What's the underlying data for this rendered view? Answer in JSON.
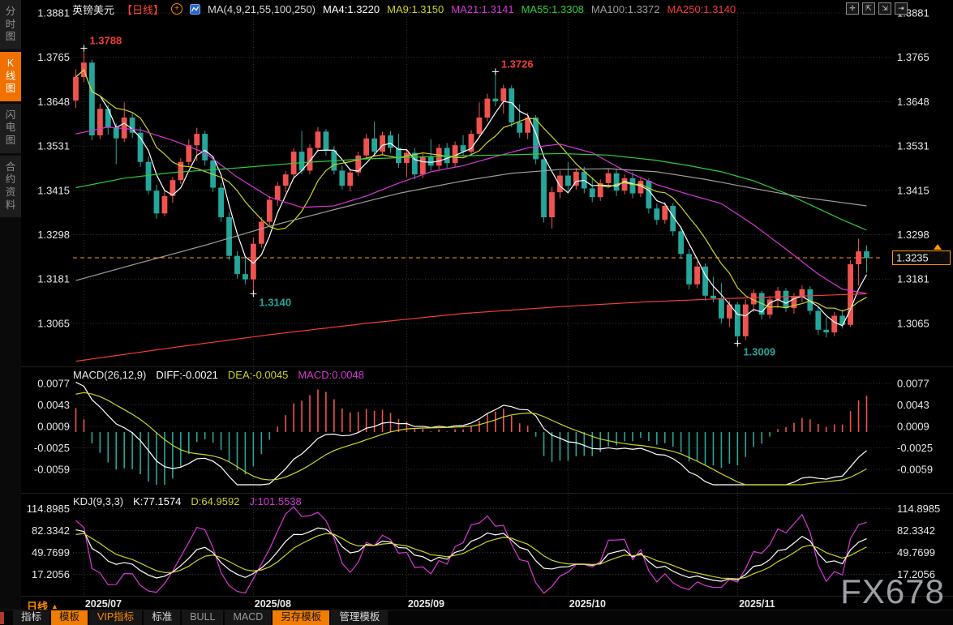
{
  "window": {
    "watermark": "FX678"
  },
  "sidebar": {
    "tabs": [
      {
        "label": "分时图",
        "active": false
      },
      {
        "label": "K线图",
        "active": true
      },
      {
        "label": "闪电图",
        "active": false
      },
      {
        "label": "合约资料",
        "active": false
      }
    ]
  },
  "header": {
    "symbol": "英镑美元",
    "period_tag": "【日线】",
    "add_icon_glyph": "+",
    "ma_settings": "MA(4,9,21,55,100,250)",
    "ma_values": [
      {
        "label": "MA4:1.3220",
        "color": "#ffffff"
      },
      {
        "label": "MA9:1.3150",
        "color": "#cdd421"
      },
      {
        "label": "MA21:1.3141",
        "color": "#d837d8"
      },
      {
        "label": "MA55:1.3308",
        "color": "#2ecc40"
      },
      {
        "label": "MA100:1.3372",
        "color": "#9e9e9e"
      },
      {
        "label": "MA250:1.3140",
        "color": "#f23c3c"
      }
    ],
    "toolbar_icons": [
      {
        "name": "pan-icon",
        "glyph": "✛"
      },
      {
        "name": "fit-left-icon",
        "glyph": "⇱"
      },
      {
        "name": "fit-right-icon",
        "glyph": "⇲"
      },
      {
        "name": "jump-latest-icon",
        "glyph": "⇥"
      }
    ]
  },
  "macd_panel": {
    "title": "MACD(26,12,9)",
    "values": [
      {
        "label": "DIFF:-0.0021",
        "color": "#ffffff"
      },
      {
        "label": "DEA:-0.0045",
        "color": "#cdd421"
      },
      {
        "label": "MACD:0.0048",
        "color": "#d837d8"
      }
    ]
  },
  "kdj_panel": {
    "title": "KDJ(9,3,3)",
    "values": [
      {
        "label": "K:77.1574",
        "color": "#ffffff"
      },
      {
        "label": "D:64.9592",
        "color": "#cdd421"
      },
      {
        "label": "J:101.5538",
        "color": "#d837d8"
      }
    ]
  },
  "footer": {
    "period_label": "日线",
    "period_arrow": "▲",
    "tabs": [
      {
        "label": "指标",
        "style": "plain"
      },
      {
        "label": "模板",
        "style": "orange-bg"
      },
      {
        "label": "VIP指标",
        "style": "orange-text"
      },
      {
        "label": "标准",
        "style": "plain"
      },
      {
        "label": "BULL",
        "style": "dim"
      },
      {
        "label": "MACD",
        "style": "dim"
      },
      {
        "label": "另存模板",
        "style": "orange-bg"
      },
      {
        "label": "管理模板",
        "style": "plain"
      }
    ]
  },
  "chart_data": {
    "type": "candlestick+indicators",
    "title": "英镑美元 日线 (GBP/USD daily)",
    "price_axis_ticks": [
      "1.3881",
      "1.3765",
      "1.3648",
      "1.3531",
      "1.3415",
      "1.3298",
      "1.3181",
      "1.3065"
    ],
    "macd_axis_ticks": [
      "0.0077",
      "0.0043",
      "0.0009",
      "-0.0025",
      "-0.0059"
    ],
    "kdj_axis_ticks": [
      "114.8985",
      "82.3342",
      "49.7699",
      "17.2056"
    ],
    "dates": [
      "2025/07",
      "2025/08",
      "2025/09",
      "2025/10",
      "2025/11"
    ],
    "month_start_indices": [
      1,
      22,
      41,
      61,
      82
    ],
    "current_price": "1.3235",
    "current_price_value": 1.3235,
    "annotations": [
      {
        "index": 1,
        "price": 1.3788,
        "label": "1.3788",
        "kind": "high"
      },
      {
        "index": 52,
        "price": 1.3726,
        "label": "1.3726",
        "kind": "high"
      },
      {
        "index": 22,
        "price": 1.314,
        "label": "1.3140",
        "kind": "low"
      },
      {
        "index": 82,
        "price": 1.3009,
        "label": "1.3009",
        "kind": "low"
      }
    ],
    "candles_ohlc": [
      [
        1.365,
        1.3732,
        1.363,
        1.3712
      ],
      [
        1.3712,
        1.3788,
        1.3698,
        1.375
      ],
      [
        1.375,
        1.3758,
        1.3545,
        1.3558
      ],
      [
        1.3558,
        1.3642,
        1.3548,
        1.3628
      ],
      [
        1.3628,
        1.3638,
        1.356,
        1.3578
      ],
      [
        1.3578,
        1.359,
        1.3482,
        1.355
      ],
      [
        1.355,
        1.3645,
        1.354,
        1.3605
      ],
      [
        1.3605,
        1.3618,
        1.3552,
        1.3565
      ],
      [
        1.3565,
        1.358,
        1.3475,
        1.3488
      ],
      [
        1.3488,
        1.3502,
        1.3402,
        1.3412
      ],
      [
        1.3412,
        1.3428,
        1.3338,
        1.3352
      ],
      [
        1.3352,
        1.3412,
        1.3345,
        1.3398
      ],
      [
        1.3398,
        1.3448,
        1.338,
        1.344
      ],
      [
        1.344,
        1.3498,
        1.343,
        1.3488
      ],
      [
        1.3488,
        1.3548,
        1.3478,
        1.3532
      ],
      [
        1.3532,
        1.3578,
        1.349,
        1.3562
      ],
      [
        1.3562,
        1.357,
        1.3478,
        1.3492
      ],
      [
        1.3492,
        1.3502,
        1.3408,
        1.342
      ],
      [
        1.342,
        1.3432,
        1.333,
        1.3342
      ],
      [
        1.3342,
        1.3355,
        1.3228,
        1.324
      ],
      [
        1.324,
        1.3252,
        1.318,
        1.3192
      ],
      [
        1.3192,
        1.3238,
        1.3165,
        1.3178
      ],
      [
        1.3178,
        1.3288,
        1.314,
        1.3272
      ],
      [
        1.3272,
        1.3342,
        1.3262,
        1.333
      ],
      [
        1.333,
        1.3398,
        1.332,
        1.3388
      ],
      [
        1.3388,
        1.3435,
        1.3372,
        1.3425
      ],
      [
        1.3425,
        1.3465,
        1.3408,
        1.3455
      ],
      [
        1.3455,
        1.3525,
        1.3445,
        1.3515
      ],
      [
        1.3515,
        1.357,
        1.3455,
        1.3465
      ],
      [
        1.3465,
        1.3535,
        1.3455,
        1.3525
      ],
      [
        1.3525,
        1.358,
        1.3515,
        1.3568
      ],
      [
        1.3568,
        1.3575,
        1.3505,
        1.3518
      ],
      [
        1.3518,
        1.353,
        1.3455,
        1.3465
      ],
      [
        1.3465,
        1.3478,
        1.3415,
        1.3425
      ],
      [
        1.3425,
        1.347,
        1.341,
        1.346
      ],
      [
        1.346,
        1.3515,
        1.345,
        1.3505
      ],
      [
        1.3505,
        1.3562,
        1.3495,
        1.355
      ],
      [
        1.355,
        1.3595,
        1.3502,
        1.3515
      ],
      [
        1.3515,
        1.3568,
        1.3505,
        1.3558
      ],
      [
        1.3558,
        1.357,
        1.3512,
        1.3525
      ],
      [
        1.3525,
        1.3562,
        1.3472,
        1.3485
      ],
      [
        1.3485,
        1.3522,
        1.3448,
        1.3512
      ],
      [
        1.3512,
        1.3525,
        1.3442,
        1.3455
      ],
      [
        1.3455,
        1.3512,
        1.3445,
        1.3502
      ],
      [
        1.3502,
        1.3548,
        1.3465,
        1.3478
      ],
      [
        1.3478,
        1.3535,
        1.3468,
        1.3525
      ],
      [
        1.3525,
        1.3538,
        1.3472,
        1.3485
      ],
      [
        1.3485,
        1.3542,
        1.3475,
        1.3532
      ],
      [
        1.3532,
        1.3558,
        1.3502,
        1.3515
      ],
      [
        1.3515,
        1.3572,
        1.3505,
        1.3562
      ],
      [
        1.3562,
        1.3645,
        1.3552,
        1.3605
      ],
      [
        1.3605,
        1.3668,
        1.3595,
        1.3655
      ],
      [
        1.3655,
        1.3726,
        1.3635,
        1.3648
      ],
      [
        1.3648,
        1.3692,
        1.3615,
        1.3682
      ],
      [
        1.3682,
        1.369,
        1.358,
        1.3592
      ],
      [
        1.3592,
        1.364,
        1.3552,
        1.3565
      ],
      [
        1.3565,
        1.3618,
        1.3548,
        1.3605
      ],
      [
        1.3605,
        1.3612,
        1.3482,
        1.3495
      ],
      [
        1.3495,
        1.3505,
        1.3328,
        1.3342
      ],
      [
        1.3342,
        1.3422,
        1.3312,
        1.3408
      ],
      [
        1.3408,
        1.3465,
        1.3392,
        1.3452
      ],
      [
        1.3452,
        1.3488,
        1.3412,
        1.3425
      ],
      [
        1.3425,
        1.3472,
        1.3415,
        1.3462
      ],
      [
        1.3462,
        1.3475,
        1.3405,
        1.3418
      ],
      [
        1.3418,
        1.3448,
        1.3382,
        1.3395
      ],
      [
        1.3395,
        1.3442,
        1.3385,
        1.3432
      ],
      [
        1.3432,
        1.347,
        1.3422,
        1.3458
      ],
      [
        1.3458,
        1.3468,
        1.3398,
        1.3412
      ],
      [
        1.3412,
        1.3455,
        1.3402,
        1.3445
      ],
      [
        1.3445,
        1.346,
        1.3392,
        1.3405
      ],
      [
        1.3405,
        1.3448,
        1.3395,
        1.3438
      ],
      [
        1.3438,
        1.3445,
        1.3352,
        1.3365
      ],
      [
        1.3365,
        1.3378,
        1.3322,
        1.3335
      ],
      [
        1.3335,
        1.3382,
        1.3325,
        1.3372
      ],
      [
        1.3372,
        1.338,
        1.3292,
        1.3305
      ],
      [
        1.3305,
        1.3318,
        1.3232,
        1.3245
      ],
      [
        1.3245,
        1.3258,
        1.3152,
        1.3165
      ],
      [
        1.3165,
        1.3225,
        1.3155,
        1.3212
      ],
      [
        1.3212,
        1.322,
        1.3122,
        1.3135
      ],
      [
        1.3135,
        1.3185,
        1.3118,
        1.3128
      ],
      [
        1.3128,
        1.3168,
        1.3062,
        1.3075
      ],
      [
        1.3075,
        1.3122,
        1.3052,
        1.3112
      ],
      [
        1.3112,
        1.3118,
        1.3009,
        1.3028
      ],
      [
        1.3028,
        1.3125,
        1.3018,
        1.3112
      ],
      [
        1.3112,
        1.3152,
        1.3092,
        1.3142
      ],
      [
        1.3142,
        1.3148,
        1.3072,
        1.3085
      ],
      [
        1.3085,
        1.3135,
        1.3075,
        1.3125
      ],
      [
        1.3125,
        1.3158,
        1.3102,
        1.3148
      ],
      [
        1.3148,
        1.3155,
        1.3092,
        1.3102
      ],
      [
        1.3102,
        1.3142,
        1.3088,
        1.3132
      ],
      [
        1.3132,
        1.3162,
        1.3118,
        1.3152
      ],
      [
        1.3152,
        1.316,
        1.3085,
        1.3095
      ],
      [
        1.3095,
        1.3105,
        1.3032,
        1.3045
      ],
      [
        1.3045,
        1.3078,
        1.3025,
        1.3038
      ],
      [
        1.3038,
        1.3092,
        1.3028,
        1.3082
      ],
      [
        1.3082,
        1.3098,
        1.3048,
        1.3058
      ],
      [
        1.3058,
        1.3228,
        1.3052,
        1.3218
      ],
      [
        1.3218,
        1.3285,
        1.3162,
        1.3252
      ],
      [
        1.3252,
        1.3268,
        1.3195,
        1.3235
      ]
    ],
    "computed_ma": [
      {
        "name": "MA4",
        "window": 4,
        "color": "#ffffff"
      },
      {
        "name": "MA9",
        "window": 9,
        "color": "#cdd421"
      }
    ],
    "ma_overlays": [
      {
        "name": "MA21",
        "color": "#d837d8",
        "points": [
          [
            0,
            1.3562
          ],
          [
            4,
            1.358
          ],
          [
            8,
            1.3572
          ],
          [
            12,
            1.3545
          ],
          [
            16,
            1.3512
          ],
          [
            20,
            1.3448
          ],
          [
            24,
            1.3395
          ],
          [
            28,
            1.3368
          ],
          [
            32,
            1.3372
          ],
          [
            36,
            1.3398
          ],
          [
            40,
            1.3432
          ],
          [
            44,
            1.3462
          ],
          [
            48,
            1.3478
          ],
          [
            52,
            1.3502
          ],
          [
            56,
            1.3525
          ],
          [
            60,
            1.3535
          ],
          [
            64,
            1.3512
          ],
          [
            68,
            1.3465
          ],
          [
            72,
            1.3428
          ],
          [
            76,
            1.3402
          ],
          [
            80,
            1.3378
          ],
          [
            84,
            1.3322
          ],
          [
            88,
            1.3258
          ],
          [
            92,
            1.3192
          ],
          [
            95,
            1.3152
          ],
          [
            98,
            1.3141
          ]
        ]
      },
      {
        "name": "MA55",
        "color": "#2ecc40",
        "points": [
          [
            0,
            1.342
          ],
          [
            6,
            1.3445
          ],
          [
            12,
            1.346
          ],
          [
            20,
            1.3472
          ],
          [
            28,
            1.3486
          ],
          [
            36,
            1.3496
          ],
          [
            44,
            1.3502
          ],
          [
            52,
            1.3506
          ],
          [
            60,
            1.351
          ],
          [
            66,
            1.3506
          ],
          [
            72,
            1.3492
          ],
          [
            76,
            1.3478
          ],
          [
            80,
            1.3462
          ],
          [
            84,
            1.3438
          ],
          [
            88,
            1.3405
          ],
          [
            92,
            1.3365
          ],
          [
            95,
            1.3335
          ],
          [
            98,
            1.3308
          ]
        ]
      },
      {
        "name": "MA100",
        "color": "#9e9e9e",
        "points": [
          [
            0,
            1.3175
          ],
          [
            8,
            1.3222
          ],
          [
            16,
            1.3268
          ],
          [
            24,
            1.3318
          ],
          [
            32,
            1.3362
          ],
          [
            40,
            1.3405
          ],
          [
            48,
            1.3438
          ],
          [
            54,
            1.3458
          ],
          [
            60,
            1.3468
          ],
          [
            66,
            1.347
          ],
          [
            72,
            1.3462
          ],
          [
            78,
            1.3442
          ],
          [
            84,
            1.3418
          ],
          [
            90,
            1.3395
          ],
          [
            98,
            1.3372
          ]
        ]
      },
      {
        "name": "MA250",
        "color": "#f23c3c",
        "points": [
          [
            0,
            1.2962
          ],
          [
            12,
            1.2998
          ],
          [
            24,
            1.3032
          ],
          [
            36,
            1.3062
          ],
          [
            48,
            1.3088
          ],
          [
            60,
            1.3106
          ],
          [
            70,
            1.3118
          ],
          [
            80,
            1.3127
          ],
          [
            90,
            1.3134
          ],
          [
            98,
            1.314
          ]
        ]
      }
    ],
    "macd_params": {
      "fast": 12,
      "slow": 26,
      "signal": 9,
      "diff_color": "#ffffff",
      "dea_color": "#cdd421",
      "hist_up_color": "#ef5350",
      "hist_down_color": "#26a69a"
    },
    "kdj_params": {
      "n": 9,
      "k_color": "#ffffff",
      "d_color": "#cdd421",
      "j_color": "#d837d8",
      "k_seed": 85,
      "d_seed": 73
    },
    "colors": {
      "up": "#ef5350",
      "down": "#26a69a",
      "grid": "#3a3a3a",
      "axis_text": "#e8e8e8",
      "accent_orange": "#ff9800",
      "annotation_high": "#f23c3c",
      "annotation_low": "#26a69a"
    }
  }
}
